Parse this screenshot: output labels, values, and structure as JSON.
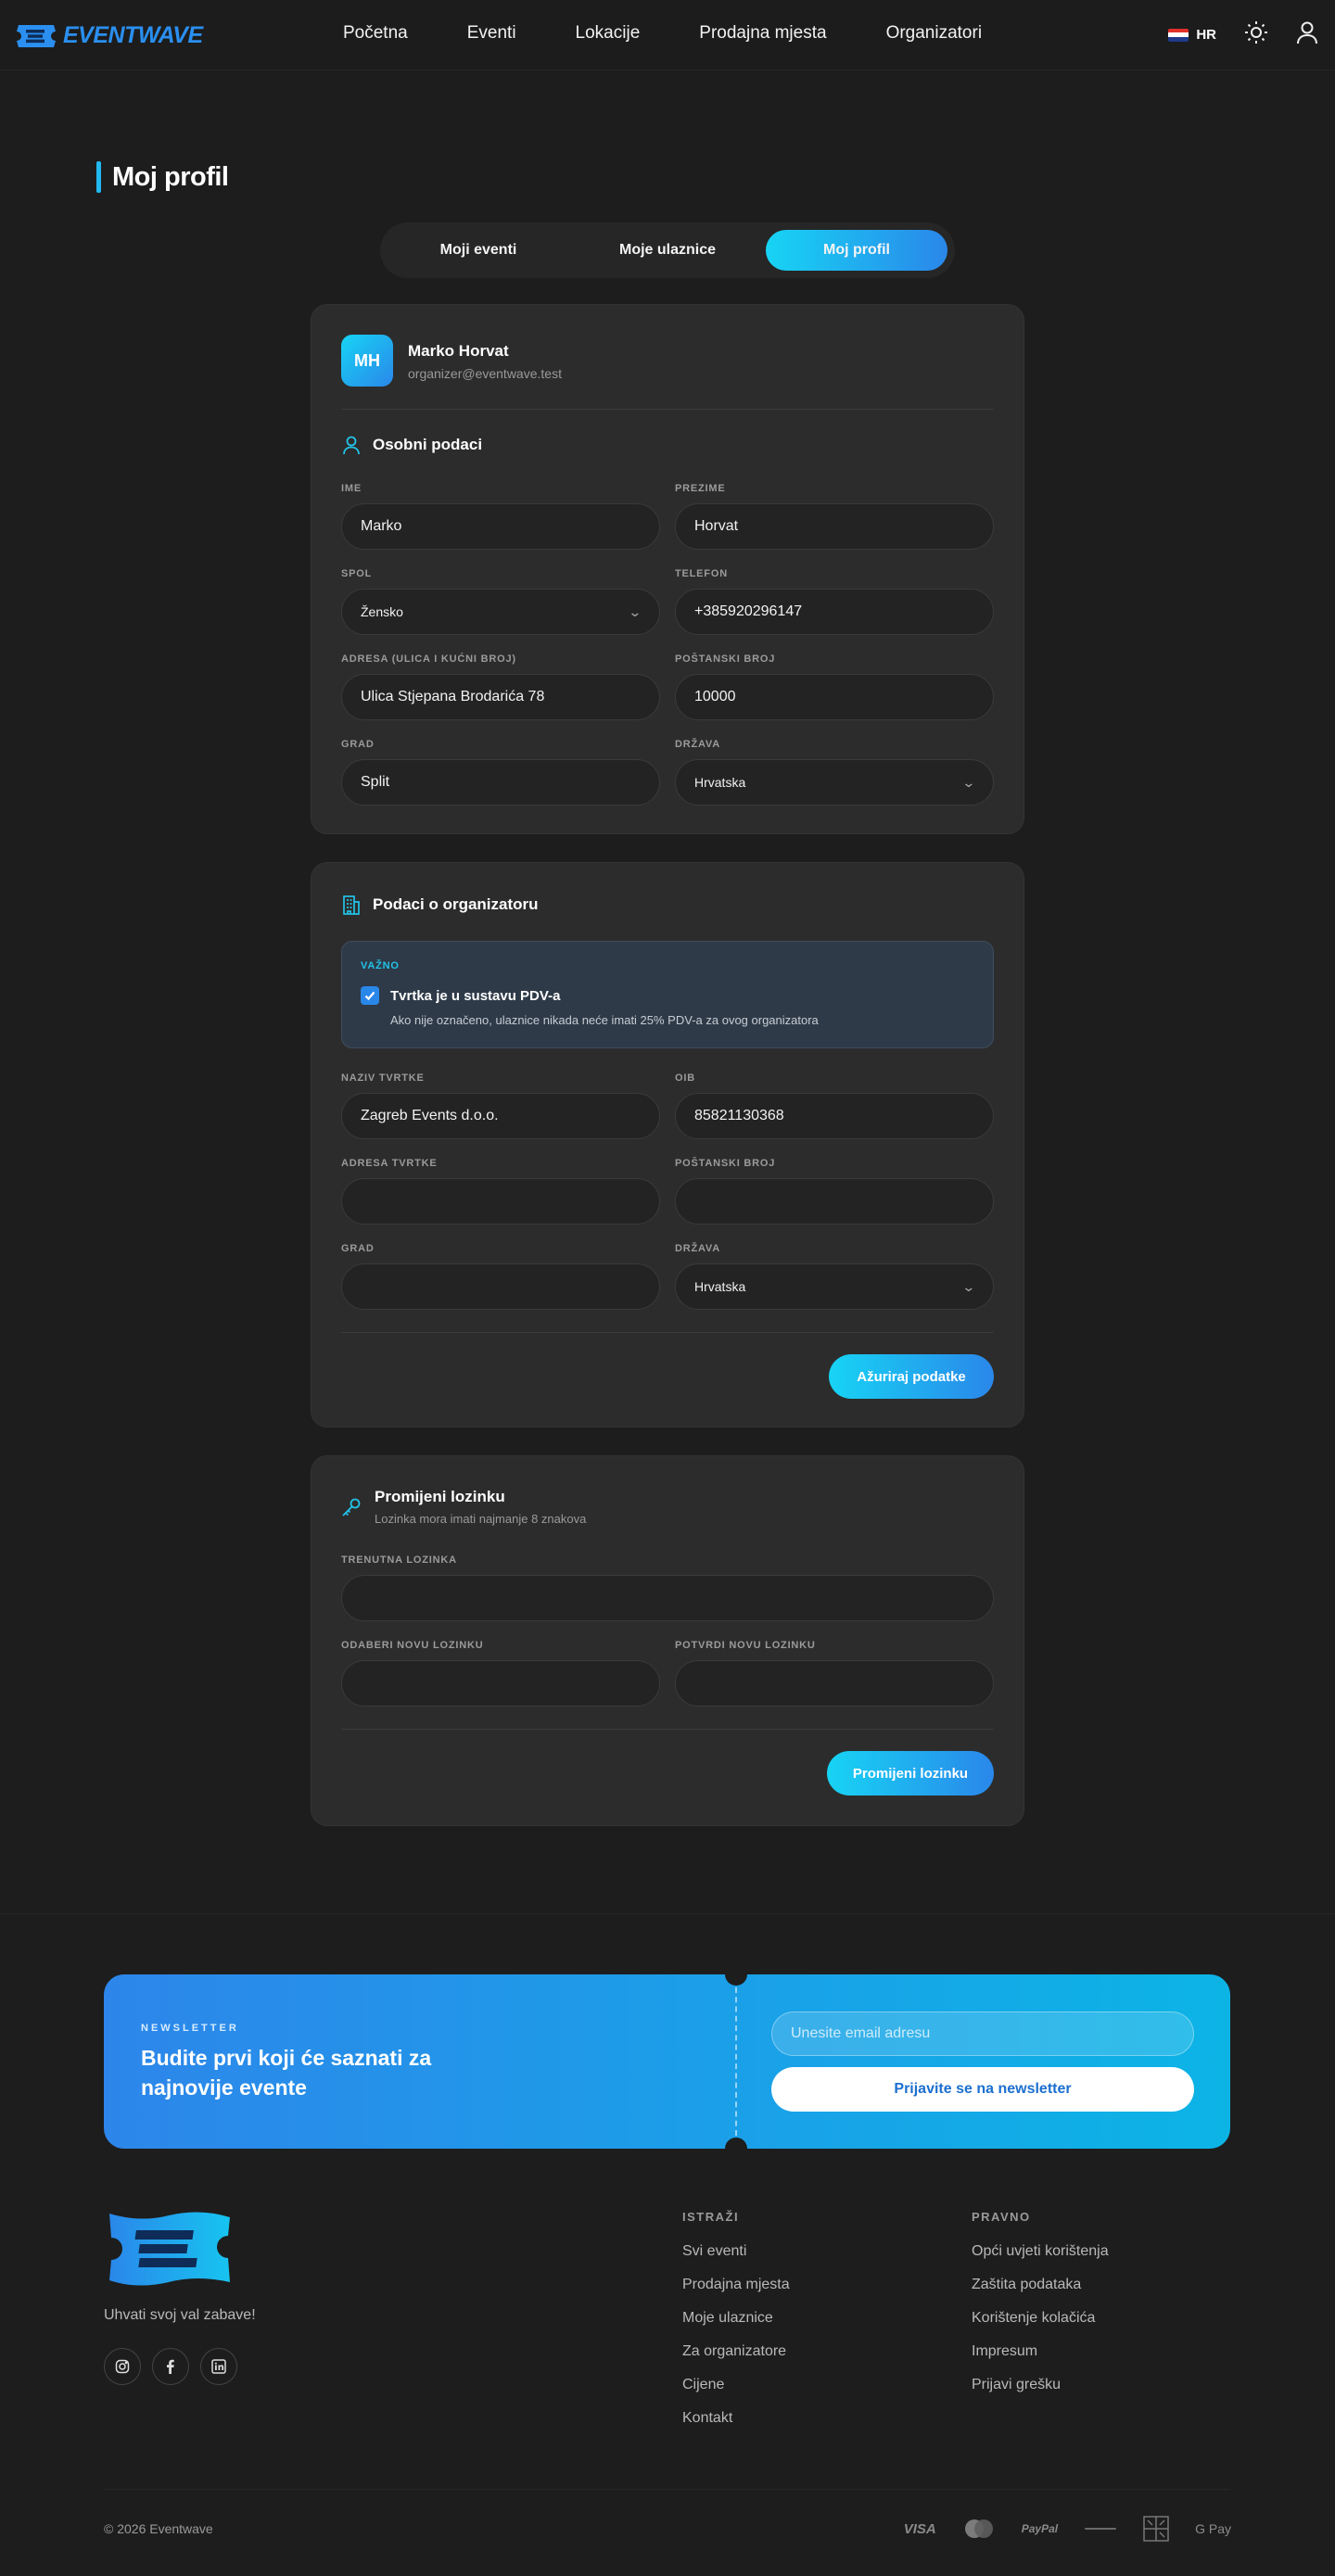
{
  "header": {
    "logo_text": "EVENTWAVE",
    "nav": [
      "Početna",
      "Eventi",
      "Lokacije",
      "Prodajna mjesta",
      "Organizatori"
    ],
    "lang": "HR"
  },
  "page_title": "Moj profil",
  "tabs": [
    {
      "label": "Moji eventi",
      "active": false
    },
    {
      "label": "Moje ulaznice",
      "active": false
    },
    {
      "label": "Moj profil",
      "active": true
    }
  ],
  "profile": {
    "initials": "MH",
    "name": "Marko Horvat",
    "email": "organizer@eventwave.test",
    "section_title": "Osobni podaci",
    "fields": {
      "ime": {
        "label": "IME",
        "value": "Marko"
      },
      "prezime": {
        "label": "PREZIME",
        "value": "Horvat"
      },
      "spol": {
        "label": "SPOL",
        "value": "Žensko"
      },
      "telefon": {
        "label": "TELEFON",
        "value": "+385920296147"
      },
      "adresa": {
        "label": "ADRESA (ULICA I KUĆNI BROJ)",
        "value": "Ulica Stjepana Brodarića 78"
      },
      "postanski": {
        "label": "POŠTANSKI BROJ",
        "value": "10000"
      },
      "grad": {
        "label": "GRAD",
        "value": "Split"
      },
      "drzava": {
        "label": "DRŽAVA",
        "value": "Hrvatska"
      }
    }
  },
  "organizer": {
    "section_title": "Podaci o organizatoru",
    "notice_tag": "VAŽNO",
    "checkbox_label": "Tvrtka je u sustavu PDV-a",
    "checkbox_checked": true,
    "checkbox_hint": "Ako nije označeno, ulaznice nikada neće imati 25% PDV-a za ovog organizatora",
    "fields": {
      "naziv": {
        "label": "NAZIV TVRTKE",
        "value": "Zagreb Events d.o.o."
      },
      "oib": {
        "label": "OIB",
        "value": "85821130368"
      },
      "adresa": {
        "label": "ADRESA TVRTKE",
        "value": ""
      },
      "postanski": {
        "label": "POŠTANSKI BROJ",
        "value": ""
      },
      "grad": {
        "label": "GRAD",
        "value": ""
      },
      "drzava": {
        "label": "DRŽAVA",
        "value": "Hrvatska"
      }
    },
    "submit_label": "Ažuriraj podatke"
  },
  "password": {
    "section_title": "Promijeni lozinku",
    "subtitle": "Lozinka mora imati najmanje 8 znakova",
    "current_label": "TRENUTNA LOZINKA",
    "new_label": "ODABERI NOVU LOZINKU",
    "confirm_label": "POTVRDI NOVU LOZINKU",
    "submit_label": "Promijeni lozinku"
  },
  "newsletter": {
    "tag": "NEWSLETTER",
    "headline": "Budite prvi koji će saznati za najnovije evente",
    "email_placeholder": "Unesite email adresu",
    "button_label": "Prijavite se na newsletter"
  },
  "footer": {
    "tagline": "Uhvati svoj val zabave!",
    "col1_title": "ISTRAŽI",
    "col1_links": [
      "Svi eventi",
      "Prodajna mjesta",
      "Moje ulaznice",
      "Za organizatore",
      "Cijene",
      "Kontakt"
    ],
    "col2_title": "PRAVNO",
    "col2_links": [
      "Opći uvjeti korištenja",
      "Zaštita podataka",
      "Korištenje kolačića",
      "Impresum",
      "Prijavi grešku"
    ],
    "copyright": "© 2026 Eventwave",
    "payments": [
      "VISA",
      "PayPal",
      "G Pay"
    ]
  },
  "colors": {
    "accent": "#22b8f0",
    "accent_gradient_start": "#17d4f4",
    "accent_gradient_end": "#2a87ea",
    "background": "#1d1d1d",
    "card": "#2c2c2c"
  }
}
